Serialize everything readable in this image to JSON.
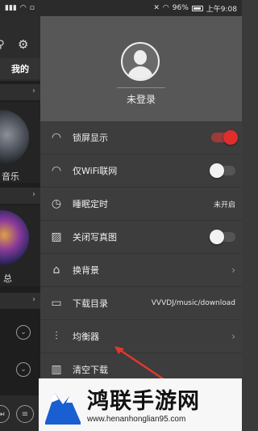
{
  "status_bar": {
    "battery": "96%",
    "time": "上午9:08"
  },
  "background": {
    "tab_label": "我的",
    "card1_label": "音乐",
    "card2_label": "总"
  },
  "drawer": {
    "profile": {
      "login_status": "未登录"
    },
    "menu": [
      {
        "icon": "gauge-icon",
        "label": "锁屏显示",
        "control": "toggle",
        "toggle_on": true
      },
      {
        "icon": "gauge-icon",
        "label": "仅WiFi联网",
        "control": "toggle",
        "toggle_on": false
      },
      {
        "icon": "timer-icon",
        "label": "睡眠定时",
        "control": "value",
        "value": "未开启"
      },
      {
        "icon": "image-icon",
        "label": "关闭写真图",
        "control": "toggle",
        "toggle_on": false
      },
      {
        "icon": "tshirt-icon",
        "label": "换背景",
        "control": "chevron"
      },
      {
        "icon": "folder-icon",
        "label": "下载目录",
        "control": "value",
        "value": "VVVDJ/music/download"
      },
      {
        "icon": "equalizer-icon",
        "label": "均衡器",
        "control": "chevron"
      },
      {
        "icon": "trash-icon",
        "label": "清空下载",
        "control": "none"
      }
    ]
  },
  "watermark": {
    "title": "鸿联手游网",
    "url": "www.henanhonglian95.com"
  },
  "colors": {
    "toggle_on": "#e02d2d",
    "drawer_bg": "#3d3d3d",
    "profile_bg": "#575757",
    "arrow": "#e0392b"
  }
}
